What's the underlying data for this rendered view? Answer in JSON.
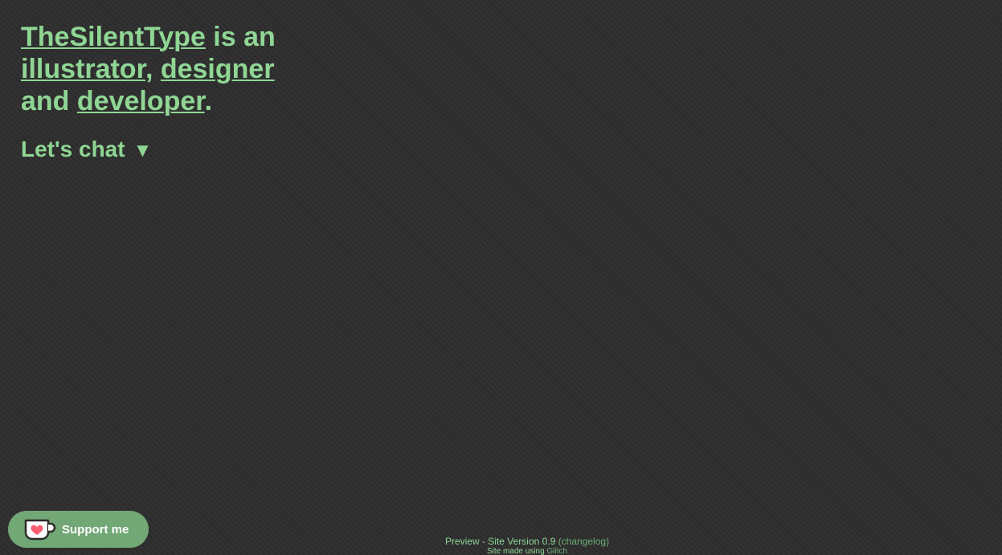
{
  "hero": {
    "name_link": "TheSilentType",
    "text_is_an": " is an ",
    "illustrator_link": "illustrator",
    "comma": ", ",
    "designer_link": "designer",
    "text_and": "and ",
    "developer_link": "developer",
    "period": "."
  },
  "chat": {
    "label": "Let's chat",
    "arrow": "▼"
  },
  "support": {
    "label": "Support me",
    "icon": "heart-cup-icon"
  },
  "footer": {
    "version_text": "Preview - Site Version 0.9",
    "changelog_link": "(changelog)",
    "made_using": "Site made using",
    "glitch_link": "Glitch"
  },
  "colors": {
    "accent": "#8fd694",
    "background": "#2e2e2e",
    "support_button": "#72a776"
  }
}
